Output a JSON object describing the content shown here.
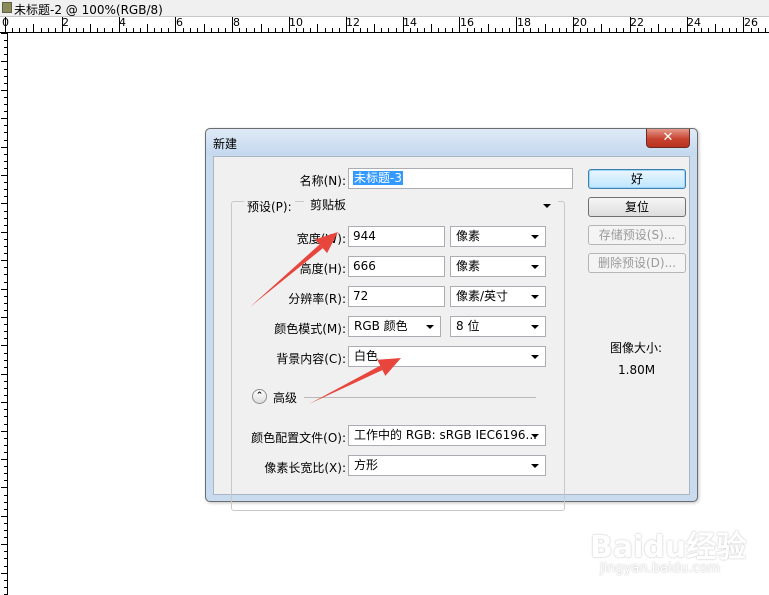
{
  "document": {
    "title": "未标题-2 @ 100%(RGB/8)"
  },
  "ruler": {
    "labels": [
      "0",
      "2",
      "4",
      "6",
      "8",
      "10",
      "12",
      "14",
      "16",
      "18",
      "20",
      "22",
      "24",
      "26"
    ]
  },
  "dialog": {
    "title": "新建",
    "close_glyph": "✕",
    "fields": {
      "name": {
        "label": "名称(N):",
        "value": "未标题-3"
      },
      "preset": {
        "label": "预设(P):",
        "value": "剪贴板"
      },
      "width": {
        "label": "宽度(W):",
        "value": "944",
        "unit": "像素"
      },
      "height": {
        "label": "高度(H):",
        "value": "666",
        "unit": "像素"
      },
      "resolution": {
        "label": "分辨率(R):",
        "value": "72",
        "unit": "像素/英寸"
      },
      "color_mode": {
        "label": "颜色模式(M):",
        "value": "RGB 颜色",
        "depth": "8 位"
      },
      "background": {
        "label": "背景内容(C):",
        "value": "白色"
      },
      "advanced": {
        "label": "高级",
        "glyph": "⌃"
      },
      "color_profile": {
        "label": "颜色配置文件(O):",
        "value": "工作中的 RGB: sRGB IEC6196..."
      },
      "pixel_aspect": {
        "label": "像素长宽比(X):",
        "value": "方形"
      }
    },
    "buttons": {
      "ok": "好",
      "reset": "复位",
      "save_preset": "存储预设(S)...",
      "delete_preset": "删除预设(D)..."
    },
    "image_size": {
      "label": "图像大小:",
      "value": "1.80M"
    }
  },
  "annotation_color": "#e8453c",
  "watermark": {
    "logo": "Baidu经验",
    "url": "jingyan.baidu.com"
  }
}
